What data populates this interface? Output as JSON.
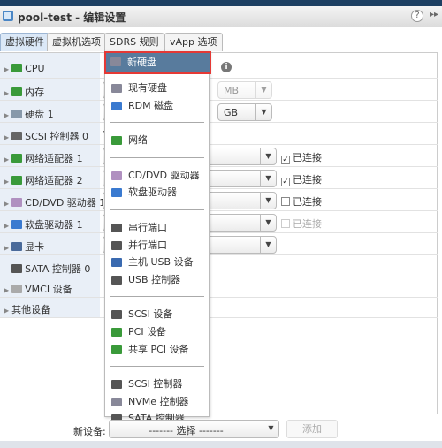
{
  "window": {
    "title": "pool-test - 编辑设置",
    "help": "?",
    "more": "▸▸"
  },
  "tabs": [
    {
      "label": "虚拟硬件",
      "active": true
    },
    {
      "label": "虚拟机选项"
    },
    {
      "label": "SDRS 规则"
    },
    {
      "label": "vApp 选项"
    }
  ],
  "hardware": [
    {
      "label": "CPU",
      "icon": "cpu-icon",
      "color": "#3a9a3a"
    },
    {
      "label": "内存",
      "icon": "memory-icon",
      "color": "#3a9a3a",
      "unit": "MB"
    },
    {
      "label": "硬盘 1",
      "icon": "disk-icon",
      "color": "#8899aa",
      "unit": "GB"
    },
    {
      "label": "SCSI 控制器 0",
      "icon": "scsi-icon",
      "color": "#666",
      "value": "V"
    },
    {
      "label": "网络适配器 1",
      "icon": "network-icon",
      "color": "#3a9a3a",
      "connected": true,
      "connect_label": "已连接"
    },
    {
      "label": "网络适配器 2",
      "icon": "network-icon",
      "color": "#3a9a3a",
      "connected": true,
      "connect_label": "已连接"
    },
    {
      "label": "CD/DVD 驱动器 1",
      "icon": "cd-icon",
      "color": "#b090c0",
      "connected": false,
      "connect_label": "已连接"
    },
    {
      "label": "软盘驱动器 1",
      "icon": "floppy-icon",
      "color": "#3a7ad0",
      "connected": false,
      "connect_label": "已连接",
      "disabled": true
    },
    {
      "label": "显卡",
      "icon": "display-icon",
      "color": "#4a6a9a"
    },
    {
      "label": "SATA 控制器 0",
      "icon": "sata-icon",
      "color": "#555"
    },
    {
      "label": "VMCI 设备",
      "icon": "gear-icon",
      "color": "#aaa"
    },
    {
      "label": "其他设备",
      "icon": "",
      "color": ""
    }
  ],
  "menu": [
    {
      "label": "新硬盘",
      "icon": "new-disk-icon",
      "color": "#889",
      "highlighted": true
    },
    {
      "label": "现有硬盘",
      "icon": "existing-disk-icon",
      "color": "#889"
    },
    {
      "label": "RDM 磁盘",
      "icon": "rdm-disk-icon",
      "color": "#3a7ad0"
    },
    {
      "sep": true
    },
    {
      "label": "网络",
      "icon": "network-icon",
      "color": "#3a9a3a"
    },
    {
      "sep": true
    },
    {
      "label": "CD/DVD 驱动器",
      "icon": "cd-icon",
      "color": "#b090c0"
    },
    {
      "label": "软盘驱动器",
      "icon": "floppy-icon",
      "color": "#3a7ad0"
    },
    {
      "sep": true
    },
    {
      "label": "串行端口",
      "icon": "serial-port-icon",
      "color": "#555"
    },
    {
      "label": "并行端口",
      "icon": "parallel-port-icon",
      "color": "#555"
    },
    {
      "label": "主机 USB 设备",
      "icon": "usb-device-icon",
      "color": "#3a6ab0"
    },
    {
      "label": "USB 控制器",
      "icon": "usb-controller-icon",
      "color": "#555"
    },
    {
      "sep": true
    },
    {
      "label": "SCSI 设备",
      "icon": "scsi-device-icon",
      "color": "#555"
    },
    {
      "label": "PCI 设备",
      "icon": "pci-icon",
      "color": "#3a9a3a"
    },
    {
      "label": "共享 PCI 设备",
      "icon": "shared-pci-icon",
      "color": "#3a9a3a"
    },
    {
      "sep": true
    },
    {
      "label": "SCSI 控制器",
      "icon": "scsi-controller-icon",
      "color": "#555"
    },
    {
      "label": "NVMe 控制器",
      "icon": "nvme-icon",
      "color": "#889"
    },
    {
      "label": "SATA 控制器",
      "icon": "sata-icon",
      "color": "#555"
    }
  ],
  "footer": {
    "new_device_label": "新设备:",
    "select_text": "------- 选择 -------",
    "add_label": "添加"
  }
}
